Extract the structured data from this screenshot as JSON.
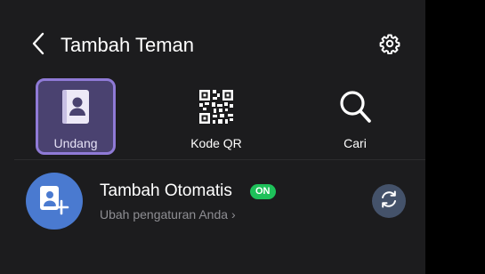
{
  "header": {
    "title": "Tambah Teman",
    "back_icon": "chevron-left-icon",
    "settings_icon": "gear-icon"
  },
  "actions": [
    {
      "label": "Undang",
      "icon": "contact-book-icon",
      "selected": true
    },
    {
      "label": "Kode QR",
      "icon": "qr-code-icon",
      "selected": false
    },
    {
      "label": "Cari",
      "icon": "search-icon",
      "selected": false
    }
  ],
  "auto_add": {
    "title": "Tambah Otomatis",
    "badge": "ON",
    "subtitle": "Ubah pengaturan Anda",
    "subtitle_chevron": "›",
    "avatar_icon": "add-contact-icon",
    "sync_icon": "sync-icon"
  },
  "colors": {
    "background": "#1c1c1e",
    "selected_tile": "#4a4270",
    "selected_border": "#8f7ad6",
    "badge_green": "#1ec15a",
    "avatar_blue": "#4a7ad0",
    "sync_button": "#44526a",
    "muted_text": "#8e8e93"
  }
}
